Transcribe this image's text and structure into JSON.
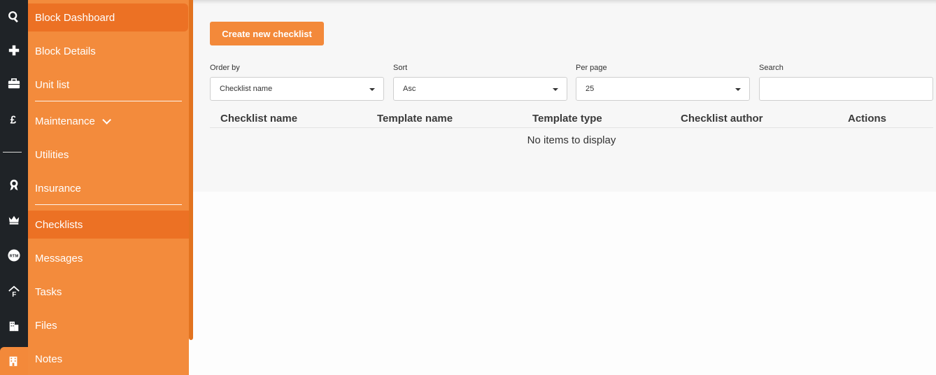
{
  "sidebar": {
    "items": [
      {
        "label": "Block Dashboard",
        "icon": "search-icon"
      },
      {
        "label": "Block Details",
        "icon": "plus-icon"
      },
      {
        "label": "Unit list",
        "icon": "briefcase-icon"
      },
      {
        "label": "Maintenance",
        "icon": "pound-icon"
      },
      {
        "label": "Utilities",
        "icon": "dash-icon"
      },
      {
        "label": "Insurance",
        "icon": "badge-icon"
      },
      {
        "label": "Checklists",
        "icon": "crown-icon"
      },
      {
        "label": "Messages",
        "icon": "rtm-icon"
      },
      {
        "label": "Tasks",
        "icon": "house-f-icon"
      },
      {
        "label": "Files",
        "icon": "building-icon"
      },
      {
        "label": "Notes",
        "icon": "office-icon"
      }
    ],
    "rtm_text": "RTM"
  },
  "toolbar": {
    "create_label": "Create new checklist"
  },
  "filters": {
    "order_by": {
      "label": "Order by",
      "value": "Checklist name"
    },
    "sort": {
      "label": "Sort",
      "value": "Asc"
    },
    "per_page": {
      "label": "Per page",
      "value": "25"
    },
    "search": {
      "label": "Search",
      "value": ""
    }
  },
  "table": {
    "columns": [
      "Checklist name",
      "Template name",
      "Template type",
      "Checklist author",
      "Actions"
    ],
    "empty_text": "No items to display"
  },
  "colors": {
    "accent": "#f38b3c",
    "accent_dark": "#ec7124",
    "rail": "#1f2327"
  }
}
